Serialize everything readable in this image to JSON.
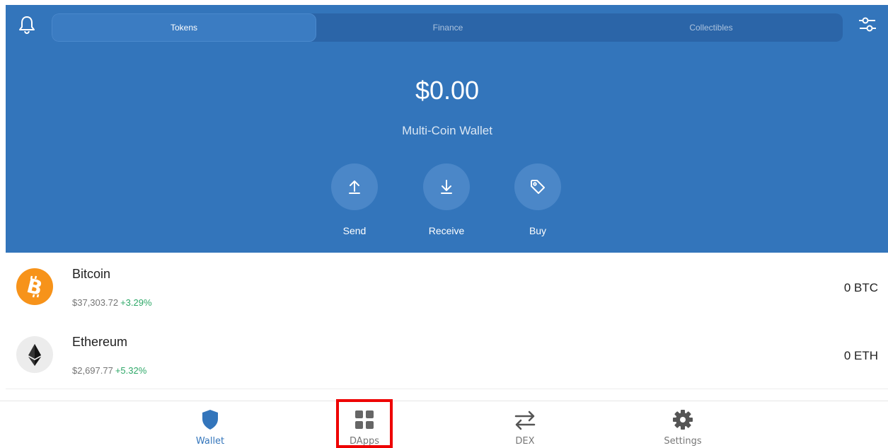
{
  "tabs": [
    {
      "label": "Tokens",
      "active": true
    },
    {
      "label": "Finance",
      "active": false
    },
    {
      "label": "Collectibles",
      "active": false
    }
  ],
  "icons": {
    "notifications": "bell-icon",
    "filter": "sliders-icon",
    "send": "upload-arrow-icon",
    "receive": "download-arrow-icon",
    "buy": "tag-icon"
  },
  "wallet": {
    "balance": "$0.00",
    "name": "Multi-Coin Wallet"
  },
  "actions": {
    "send": "Send",
    "receive": "Receive",
    "buy": "Buy"
  },
  "coins": [
    {
      "name": "Bitcoin",
      "price": "$37,303.72",
      "change": "+3.29%",
      "amount": "0 BTC",
      "icon": "bitcoin-icon",
      "color": "#f7931a"
    },
    {
      "name": "Ethereum",
      "price": "$2,697.77",
      "change": "+5.32%",
      "amount": "0 ETH",
      "icon": "ethereum-icon",
      "color": "#ececec"
    }
  ],
  "nav": [
    {
      "label": "Wallet",
      "icon": "shield-icon",
      "active": true
    },
    {
      "label": "DApps",
      "icon": "grid-icon",
      "active": false
    },
    {
      "label": "DEX",
      "icon": "swap-arrows-icon",
      "active": false
    },
    {
      "label": "Settings",
      "icon": "gear-icon",
      "active": false
    }
  ],
  "colors": {
    "primary": "#3375bb",
    "positive": "#2ea868",
    "highlight": "#ee0000"
  }
}
